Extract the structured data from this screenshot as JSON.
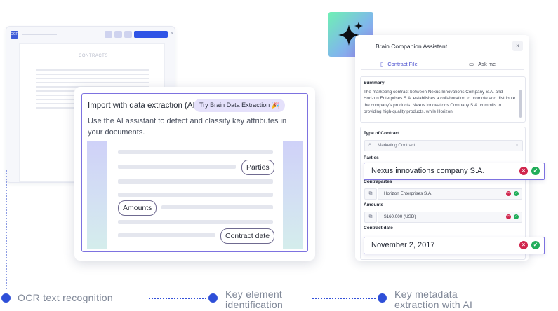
{
  "background_window": {
    "icon_label": "OCR",
    "page_title": "CONTRACTS"
  },
  "import_card": {
    "title": "Import with data extraction (AI)",
    "try_button": "Try Brain Data Extraction 🎉",
    "description": "Use the AI assistant to detect and classify key attributes in your documents.",
    "tags": {
      "parties": "Parties",
      "amounts": "Amounts",
      "contract_date": "Contract date"
    }
  },
  "assistant_panel": {
    "title": "Brain Companion Assistant",
    "close_label": "×",
    "tabs": [
      {
        "label": "Contract File",
        "icon": "document-icon",
        "active": true
      },
      {
        "label": "Ask me",
        "icon": "chat-icon",
        "active": false
      }
    ],
    "summary": {
      "label": "Summary",
      "text": "The marketing contract between Nexus Innovations Company S.A. and Horizon Enterprises S.A. establishes a collaboration to promote and distribute the company's products. Nexus Innovations Company S.A. commits to providing high-quality products, while Horizon"
    },
    "fields": {
      "type_of_contract": {
        "label": "Type of Contract",
        "value": "Marketing Contract"
      },
      "parties": {
        "label": "Parties",
        "value": "Nexus innovations company S.A."
      },
      "contrapartes": {
        "label": "Contrapartes",
        "value": "Horizon Enterprises S.A."
      },
      "amounts": {
        "label": "Amounts",
        "value": "$160.000 (USD)"
      },
      "contract_date": {
        "label": "Contract date",
        "value": "November 2, 2017"
      }
    }
  },
  "steps": [
    {
      "label": "OCR text recognition"
    },
    {
      "label_line1": "Key element",
      "label_line2": "identification"
    },
    {
      "label_line1": "Key metadata",
      "label_line2": "extraction with AI"
    }
  ],
  "colors": {
    "accent": "#7d72e0",
    "step_dot": "#2e4fd8",
    "reject": "#d0264d",
    "approve": "#21ad5a"
  }
}
